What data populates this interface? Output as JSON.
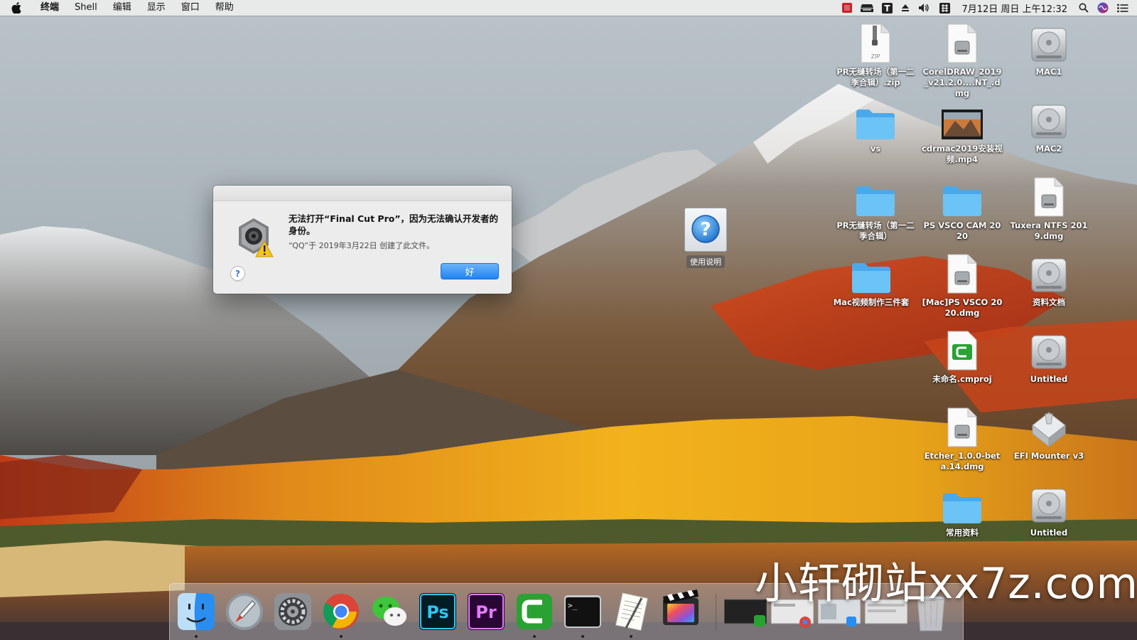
{
  "menubar": {
    "app_name": "终端",
    "items": [
      "Shell",
      "编辑",
      "显示",
      "窗口",
      "帮助"
    ],
    "clock": "7月12日 周日 上午12:32"
  },
  "alert": {
    "title": "无法打开“Final Cut Pro”，因为无法确认开发者的身份。",
    "info": "“QQ”于 2019年3月22日 创建了此文件。",
    "help_label": "?",
    "ok_label": "好"
  },
  "help_app": {
    "label": "使用说明"
  },
  "desktop_icons": [
    {
      "kind": "zip",
      "badge": "ZIP",
      "label": "PR无缝转场（第一二季合辑）.zip"
    },
    {
      "kind": "dmg",
      "label": "CorelDRAW_2019_v21.2.0....NT_.dmg"
    },
    {
      "kind": "disk",
      "label": "MAC1"
    },
    {
      "kind": "folder",
      "label": "vs"
    },
    {
      "kind": "video",
      "label": "cdrmac2019安装视频.mp4"
    },
    {
      "kind": "disk",
      "label": "MAC2"
    },
    {
      "kind": "folder",
      "label": "PR无缝转场（第一二季合辑）"
    },
    {
      "kind": "folder",
      "label": "PS VSCO CAM 2020"
    },
    {
      "kind": "dmg",
      "label": "Tuxera NTFS 2019.dmg"
    },
    {
      "kind": "folder",
      "label": "Mac视频制作三件套"
    },
    {
      "kind": "dmg",
      "label": "[Mac]PS VSCO 2020.dmg"
    },
    {
      "kind": "disk",
      "label": "资料文档"
    },
    {
      "kind": "cmproj",
      "label": "未命名.cmproj"
    },
    {
      "kind": "disk",
      "label": "Untitled"
    },
    {
      "kind": "dmg",
      "label": "Etcher_1.0.0-beta.14.dmg"
    },
    {
      "kind": "efi",
      "label": "EFI Mounter v3"
    },
    {
      "kind": "folder",
      "label": "常用资料"
    },
    {
      "kind": "disk",
      "label": "Untitled"
    }
  ],
  "dock": {
    "apps": [
      {
        "name": "finder-icon",
        "running": true
      },
      {
        "name": "launchpad-icon",
        "running": false
      },
      {
        "name": "system-preferences-icon",
        "running": false
      },
      {
        "name": "chrome-icon",
        "running": true
      },
      {
        "name": "wechat-icon",
        "running": false
      },
      {
        "name": "photoshop-icon",
        "running": false,
        "text": "Ps"
      },
      {
        "name": "premiere-icon",
        "running": false,
        "text": "Pr"
      },
      {
        "name": "camtasia-icon",
        "running": true
      },
      {
        "name": "terminal-icon",
        "running": true,
        "text": ">_"
      },
      {
        "name": "textedit-icon",
        "running": true
      },
      {
        "name": "final-cut-pro-icon",
        "running": false
      }
    ]
  },
  "watermark": "小轩砌站xx7z.com",
  "colors": {
    "ok_button": "#1f84f4",
    "folder": "#5ab7f0",
    "menubar": "#ececec"
  }
}
